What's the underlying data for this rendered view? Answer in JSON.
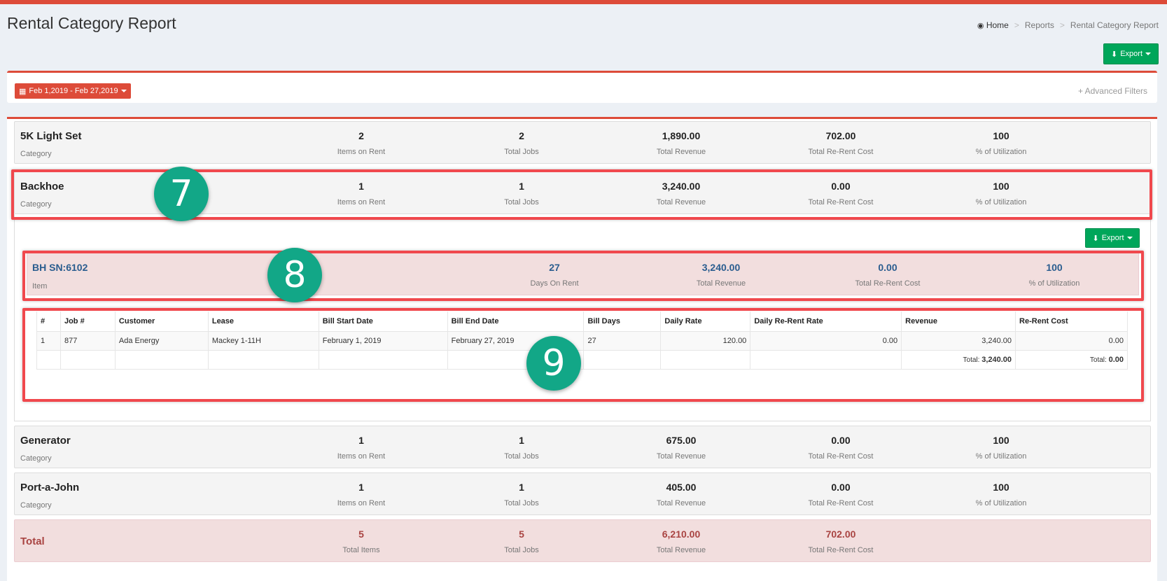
{
  "header": {
    "title": "Rental Category Report",
    "breadcrumb": [
      "Home",
      "Reports",
      "Rental Category Report"
    ],
    "breadcrumb_sep": ">",
    "export_label": "Export"
  },
  "filters": {
    "date_range": "Feb 1,2019 - Feb 27,2019",
    "advanced_filters": "Advanced Filters"
  },
  "categories": [
    {
      "name": "5K Light Set",
      "sub": "Category",
      "items_on_rent": "2",
      "total_jobs": "2",
      "total_revenue": "1,890.00",
      "rerent_cost": "702.00",
      "utilization": "100"
    },
    {
      "name": "Backhoe",
      "sub": "Category",
      "items_on_rent": "1",
      "total_jobs": "1",
      "total_revenue": "3,240.00",
      "rerent_cost": "0.00",
      "utilization": "100"
    },
    {
      "name": "Generator",
      "sub": "Category",
      "items_on_rent": "1",
      "total_jobs": "1",
      "total_revenue": "675.00",
      "rerent_cost": "0.00",
      "utilization": "100"
    },
    {
      "name": "Port-a-John",
      "sub": "Category",
      "items_on_rent": "1",
      "total_jobs": "1",
      "total_revenue": "405.00",
      "rerent_cost": "0.00",
      "utilization": "100"
    }
  ],
  "labels": {
    "items_on_rent": "Items on Rent",
    "total_jobs": "Total Jobs",
    "total_revenue": "Total Revenue",
    "rerent_cost": "Total Re-Rent Cost",
    "utilization": "% of Utilization",
    "days_on_rent": "Days On Rent",
    "total_items": "Total Items"
  },
  "expanded": {
    "export_label": "Export",
    "item": {
      "name": "BH SN:6102",
      "sub": "Item",
      "days_on_rent": "27",
      "total_revenue": "3,240.00",
      "rerent_cost": "0.00",
      "utilization": "100"
    },
    "columns": [
      "#",
      "Job #",
      "Customer",
      "Lease",
      "Bill Start Date",
      "Bill End Date",
      "Bill Days",
      "Daily Rate",
      "Daily Re-Rent Rate",
      "Revenue",
      "Re-Rent Cost"
    ],
    "rows": [
      [
        "1",
        "877",
        "Ada Energy",
        "Mackey 1-11H",
        "February 1, 2019",
        "February 27, 2019",
        "27",
        "120.00",
        "0.00",
        "3,240.00",
        "0.00"
      ]
    ],
    "totals": {
      "label": "Total:",
      "revenue": "3,240.00",
      "rerent_cost": "0.00"
    }
  },
  "total": {
    "name": "Total",
    "total_items": "5",
    "total_jobs": "5",
    "total_revenue": "6,210.00",
    "rerent_cost": "702.00"
  },
  "annotations": [
    "7",
    "8",
    "9"
  ],
  "colors": {
    "accent": "#dd4b39",
    "success": "#00a65a",
    "highlight": "#f0484d",
    "badge": "#12a787"
  }
}
